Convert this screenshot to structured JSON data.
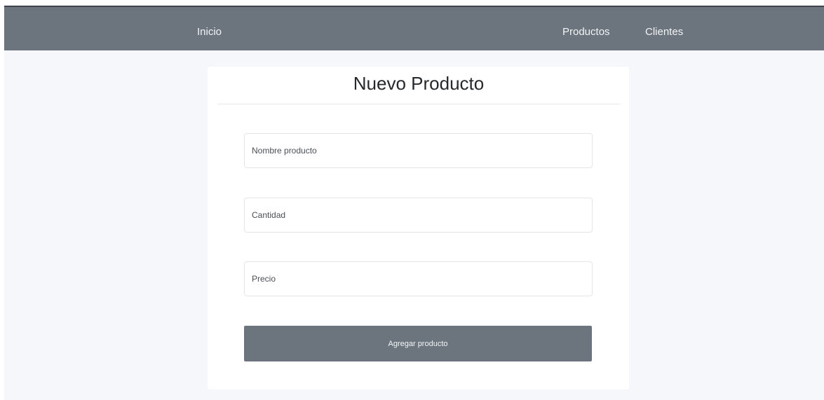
{
  "navbar": {
    "home_label": "Inicio",
    "products_label": "Productos",
    "clients_label": "Clientes"
  },
  "form": {
    "title": "Nuevo Producto",
    "name_placeholder": "Nombre producto",
    "quantity_placeholder": "Cantidad",
    "price_placeholder": "Precio",
    "name_value": "",
    "quantity_value": "",
    "price_value": "",
    "submit_label": "Agregar producto"
  },
  "colors": {
    "navbar_bg": "#6c757d",
    "page_bg": "#f5f7fa",
    "button_bg": "#6c757d"
  }
}
